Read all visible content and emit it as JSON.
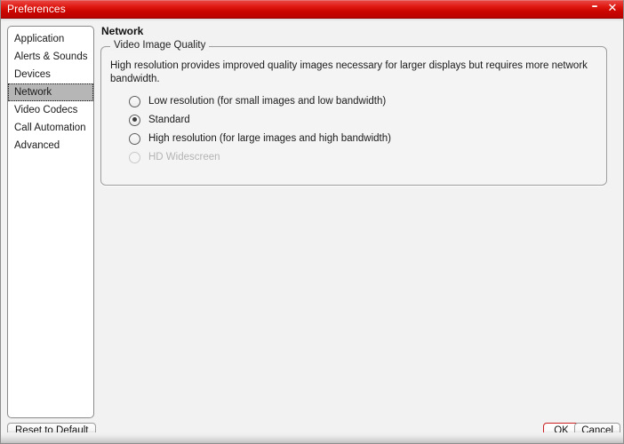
{
  "window": {
    "title": "Preferences",
    "minimize_glyph": "–",
    "close_glyph": "✕"
  },
  "sidebar": {
    "items": [
      {
        "label": "Application",
        "selected": false
      },
      {
        "label": "Alerts & Sounds",
        "selected": false
      },
      {
        "label": "Devices",
        "selected": false
      },
      {
        "label": "Network",
        "selected": true
      },
      {
        "label": "Video Codecs",
        "selected": false
      },
      {
        "label": "Call Automation",
        "selected": false
      },
      {
        "label": "Advanced",
        "selected": false
      }
    ],
    "reset_label": "Reset to Default"
  },
  "pane": {
    "title": "Network",
    "group": {
      "legend": "Video Image Quality",
      "description": "High resolution provides improved quality images necessary for larger displays but requires more network bandwidth.",
      "options": [
        {
          "label": "Low resolution (for small images and low bandwidth)",
          "checked": false,
          "disabled": false
        },
        {
          "label": "Standard",
          "checked": true,
          "disabled": false
        },
        {
          "label": "High resolution (for large images and high bandwidth)",
          "checked": false,
          "disabled": false
        },
        {
          "label": "HD Widescreen",
          "checked": false,
          "disabled": true
        }
      ]
    }
  },
  "footer": {
    "ok_label": "OK",
    "cancel_label": "Cancel"
  },
  "colors": {
    "titlebar_red": "#cc0600",
    "accent_red": "#cc1f22",
    "selection_gray": "#b6b6b6",
    "pane_background": "#f2f2f2"
  }
}
